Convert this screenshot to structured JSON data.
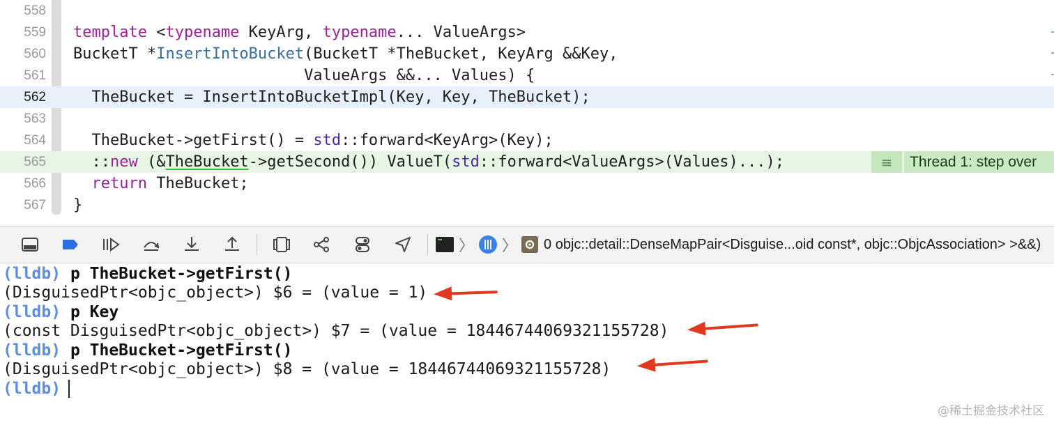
{
  "editor": {
    "lines": [
      {
        "number": "558",
        "text": ""
      },
      {
        "number": "559",
        "text": ""
      },
      {
        "number": "560",
        "text": ""
      },
      {
        "number": "561",
        "text": ""
      },
      {
        "number": "562",
        "text": ""
      },
      {
        "number": "563",
        "text": ""
      },
      {
        "number": "564",
        "text": ""
      },
      {
        "number": "565",
        "text": ""
      },
      {
        "number": "566",
        "text": ""
      },
      {
        "number": "567",
        "text": ""
      }
    ],
    "code": {
      "l559a": "template",
      "l559b": " <",
      "l559c": "typename",
      "l559d": " KeyArg, ",
      "l559e": "typename",
      "l559f": "... ValueArgs>",
      "l560a": "BucketT *",
      "l560b": "InsertIntoBucket",
      "l560c": "(BucketT *TheBucket, KeyArg &&Key,",
      "l561": "                         ValueArgs &&... Values) {",
      "l562": "  TheBucket = InsertIntoBucketImpl(Key, Key, TheBucket);",
      "l564a": "  TheBucket->getFirst() = ",
      "l564b": "std",
      "l564c": "::forward<KeyArg>(Key);",
      "l565a": "  ::",
      "l565b": "new",
      "l565c": " (&",
      "l565d": "TheBucket",
      "l565e": "->getSecond()) ValueT(",
      "l565f": "std",
      "l565g": "::forward<ValueArgs>(Values)...);",
      "l566a": "  ",
      "l566b": "return",
      "l566c": " TheBucket;",
      "l567": "}"
    },
    "thread_annotation": {
      "icon": "lines-icon",
      "label": "Thread 1: step over"
    }
  },
  "debug_bar": {
    "frame": "0 objc::detail::DenseMapPair<Disguise...oid const*, objc::ObjcAssociation> >&&)"
  },
  "console": {
    "lines": [
      {
        "prompt": "(lldb)",
        "command": " p TheBucket->getFirst()"
      },
      {
        "output": "(DisguisedPtr<objc_object>) $6 = (value = 1)"
      },
      {
        "prompt": "(lldb)",
        "command": " p Key"
      },
      {
        "output": "(const DisguisedPtr<objc_object>) $7 = (value = 18446744069321155728)"
      },
      {
        "prompt": "(lldb)",
        "command": " p TheBucket->getFirst()"
      },
      {
        "output": "(DisguisedPtr<objc_object>) $8 = (value = 18446744069321155728)"
      },
      {
        "prompt": "(lldb)",
        "command": " "
      }
    ]
  },
  "watermark": "@稀土掘金技术社区",
  "colors": {
    "keyword": "#9b2393",
    "function": "#3a6f9e",
    "namespace": "#4a2ba0",
    "prompt": "#5c8de0",
    "annotation_arrow": "#e03a1e",
    "current_line": "#e8f1fb",
    "paused_line": "#e7f5e4"
  }
}
